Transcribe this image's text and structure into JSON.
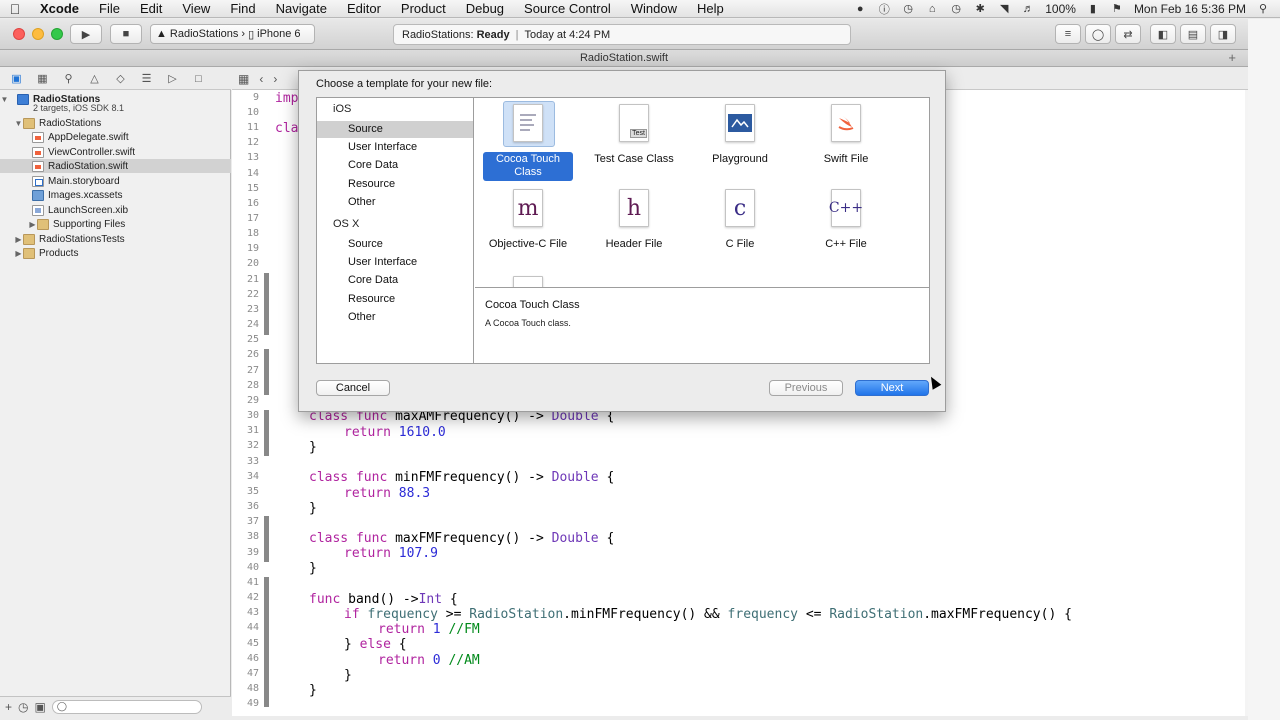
{
  "menubar": {
    "app": "Xcode",
    "items": [
      "File",
      "Edit",
      "View",
      "Find",
      "Navigate",
      "Editor",
      "Product",
      "Debug",
      "Source Control",
      "Window",
      "Help"
    ],
    "battery": "100%",
    "clock": "Mon Feb 16  5:36 PM"
  },
  "toolbar": {
    "scheme": "RadioStations",
    "device": "iPhone 6",
    "status_project": "RadioStations:",
    "status_state": "Ready",
    "status_time": "Today at 4:24 PM"
  },
  "tab": {
    "title": "RadioStation.swift",
    "plus": "+"
  },
  "navigator": {
    "project": "RadioStations",
    "project_sub": "2 targets, iOS SDK 8.1",
    "items": [
      {
        "label": "RadioStations"
      },
      {
        "label": "AppDelegate.swift"
      },
      {
        "label": "ViewController.swift"
      },
      {
        "label": "RadioStation.swift"
      },
      {
        "label": "Main.storyboard"
      },
      {
        "label": "Images.xcassets"
      },
      {
        "label": "LaunchScreen.xib"
      },
      {
        "label": "Supporting Files"
      },
      {
        "label": "RadioStationsTests"
      },
      {
        "label": "Products"
      }
    ]
  },
  "editor": {
    "line_numbers": [
      "9",
      "10",
      "11",
      "12",
      "13",
      "14",
      "15",
      "16",
      "17",
      "18",
      "19",
      "20",
      "21",
      "22",
      "23",
      "24",
      "25",
      "26",
      "27",
      "28",
      "29",
      "30",
      "31",
      "32",
      "33",
      "34",
      "35",
      "36",
      "37",
      "38",
      "39",
      "40",
      "41",
      "42",
      "43",
      "44",
      "45",
      "46",
      "47",
      "48",
      "49"
    ],
    "peek_line_9": "imp",
    "peek_line_11": "cla"
  },
  "sheet": {
    "title": "Choose a template for your new file:",
    "platforms": [
      {
        "name": "iOS",
        "categories": [
          "Source",
          "User Interface",
          "Core Data",
          "Resource",
          "Other"
        ]
      },
      {
        "name": "OS X",
        "categories": [
          "Source",
          "User Interface",
          "Core Data",
          "Resource",
          "Other"
        ]
      }
    ],
    "templates": [
      {
        "label": "Cocoa Touch Class",
        "icon": "cocoa-touch-class-icon"
      },
      {
        "label": "Test Case Class",
        "icon": "test-case-class-icon",
        "badge": "Test"
      },
      {
        "label": "Playground",
        "icon": "playground-icon"
      },
      {
        "label": "Swift File",
        "icon": "swift-file-icon"
      },
      {
        "label": "Objective-C File",
        "icon": "objective-c-file-icon",
        "glyph": "m"
      },
      {
        "label": "Header File",
        "icon": "header-file-icon",
        "glyph": "h"
      },
      {
        "label": "C File",
        "icon": "c-file-icon",
        "glyph": "c"
      },
      {
        "label": "C++ File",
        "icon": "cpp-file-icon",
        "glyph": "C++"
      }
    ],
    "description_title": "Cocoa Touch Class",
    "description_text": "A Cocoa Touch class.",
    "cancel_label": "Cancel",
    "previous_label": "Previous",
    "next_label": "Next"
  },
  "colors": {
    "selection_blue": "#2d6fd4",
    "keyword": "#b0249f",
    "number": "#2c2bd7",
    "comment": "#008a1a"
  }
}
